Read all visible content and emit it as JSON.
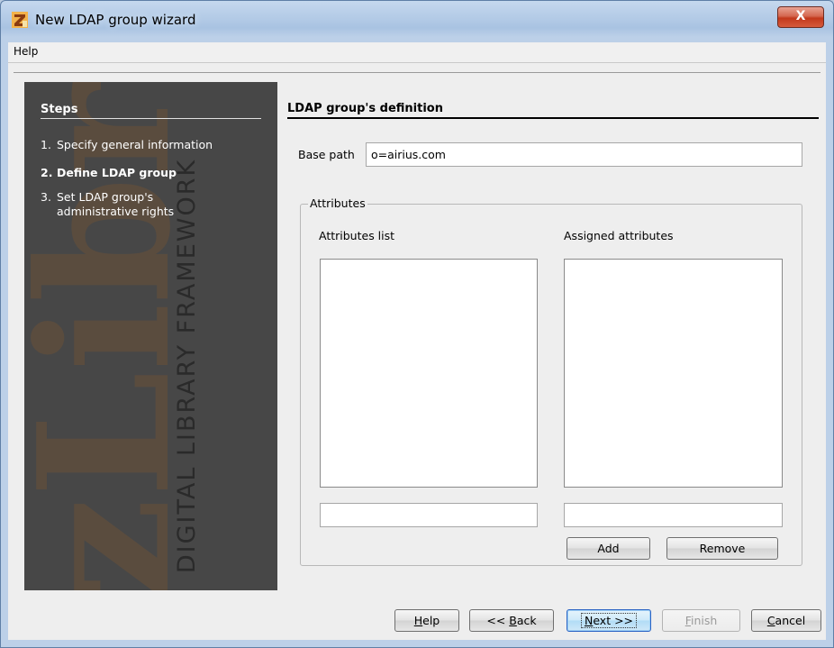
{
  "window": {
    "title": "New LDAP group wizard",
    "close_glyph": "X",
    "icon": "zlibrary-z-icon"
  },
  "menu": {
    "help": "Help"
  },
  "steps": {
    "title": "Steps",
    "items": [
      {
        "num": "1.",
        "label": "Specify general information"
      },
      {
        "num": "2.",
        "label": "Define LDAP group"
      },
      {
        "num": "3.",
        "label": "Set LDAP group's",
        "label2": "administrative rights"
      }
    ],
    "watermark_logo": "zLibra",
    "watermark_text": "DIGITAL LIBRARY FRAMEWORK"
  },
  "form": {
    "title": "LDAP group's definition",
    "base_path_label": "Base path",
    "base_path_value": "o=airius.com",
    "attributes_legend": "Attributes",
    "attributes_list_label": "Attributes list",
    "assigned_attributes_label": "Assigned attributes",
    "attributes_filter_value": "",
    "assigned_filter_value": "",
    "add_label": "Add",
    "remove_label": "Remove"
  },
  "buttons": {
    "help": {
      "key": "H",
      "rest": "elp"
    },
    "back": {
      "pre": "<< ",
      "key": "B",
      "rest": "ack"
    },
    "next": {
      "key": "N",
      "rest": "ext >>"
    },
    "finish": {
      "key": "F",
      "rest": "inish"
    },
    "cancel": {
      "key": "C",
      "rest": "ancel"
    }
  }
}
